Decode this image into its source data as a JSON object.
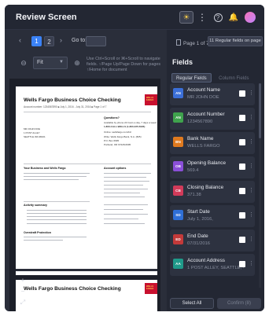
{
  "header": {
    "title": "Review Screen"
  },
  "nav": {
    "pages": [
      "1",
      "2"
    ],
    "goto_label": "Go to:",
    "page_info": "Page 1 of 7",
    "fields_pill": "11 Regular fields on page"
  },
  "toolbar": {
    "zoom_mode": "Fit",
    "hint": "Use Ctrl+Scroll or ⌘+Scroll to navigate fields. ↑/Page Up/Page Down for pages ↑/Home for document"
  },
  "document": {
    "title": "Wells Fargo Business Choice Checking",
    "subtitle": "Account number: 1234567890  ■  July 1, 2016 - July 31, 2016  ■  Page 1 of 7",
    "logo": "WELLS FARGO",
    "holder_lines": [
      "MR JOHN DOE",
      "1 POST ALLEY",
      "SEATTLE WA 98101"
    ],
    "questions_title": "Questions?",
    "questions_lines": [
      "Available by phone 24 hours a day, 7 days a week:",
      "1-800-CALL-WELLS (1-800-225-5935)",
      "Online: wellsfargo.com/biz",
      "Write: Wells Fargo Bank, N.A. (825)",
      "P.O. Box 6995",
      "Portland, OR 97228-6995"
    ],
    "section1": "Your Business and Wells Fargo",
    "section2": "Account options",
    "activity": "Activity summary",
    "overdraft": "Overdraft Protection",
    "title2": "Wells Fargo Business Choice Checking"
  },
  "fields_panel": {
    "heading": "Fields",
    "tabs": [
      "Regular Fields",
      "Column Fields"
    ],
    "items": [
      {
        "badge": "AN",
        "name": "Account Name",
        "value": "MR JOHN DOE",
        "color": "#3b6fd8"
      },
      {
        "badge": "AN",
        "name": "Account Number",
        "value": "1234567890",
        "color": "#3fa34d"
      },
      {
        "badge": "BN",
        "name": "Bank Name",
        "value": "WELLS FARGO",
        "color": "#e07a1f"
      },
      {
        "badge": "OB",
        "name": "Opening Balance",
        "value": "569.4",
        "color": "#8a4fd8"
      },
      {
        "badge": "CB",
        "name": "Closing Balance",
        "value": "371.38",
        "color": "#d23b5a"
      },
      {
        "badge": "SD",
        "name": "Start Date",
        "value": "July 1, 2016,",
        "color": "#2f6fd6"
      },
      {
        "badge": "ED",
        "name": "End Date",
        "value": "07/31/2016",
        "color": "#c33a3a"
      },
      {
        "badge": "AA",
        "name": "Account Address",
        "value": "1 POST ALLEY, SEATTLE, WA ...",
        "color": "#1f9a8a"
      }
    ],
    "select_all": "Select All",
    "confirm": "Confirm (8)"
  }
}
